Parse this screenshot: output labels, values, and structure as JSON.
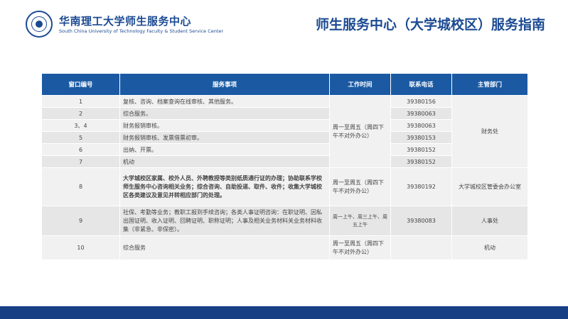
{
  "header": {
    "logo_cn": "华南理工大学师生服务中心",
    "logo_en": "South China University of Technology Faculty & Student Service Center",
    "title": "师生服务中心（大学城校区）服务指南"
  },
  "table": {
    "headers": [
      "窗口编号",
      "服务事项",
      "工作时间",
      "联系电话",
      "主管部门"
    ],
    "rows": [
      {
        "no": "1",
        "service": "复核、咨询、档案查询在线审核、其他服务。",
        "phone": "39380156"
      },
      {
        "no": "2",
        "service": "综合服务。",
        "phone": "39380063"
      },
      {
        "no": "3、4",
        "service": "财务报销审核。",
        "phone": "39380063"
      },
      {
        "no": "5",
        "service": "财务报销审核、发票借票初审。",
        "phone": "39380153"
      },
      {
        "no": "6",
        "service": "出纳、开票。",
        "phone": "39380152"
      },
      {
        "no": "7",
        "service": "机动",
        "phone": "39380152"
      },
      {
        "no": "8",
        "service": "大学城校区家属、校外人员、外聘教授等类别纸质通行证的办理；协助联系学校师生服务中心咨询相关业务；综合咨询、自助投递、取件、收件；收集大学城校区各类建议及意见并转相应部门的处理。",
        "time": "周一至周五（周四下午不对外办公）",
        "phone": "39380192",
        "dept": "大学城校区管委会办公室"
      },
      {
        "no": "9",
        "service": "社保、考勤等业务；教职工报到手续咨询；各类人事证明咨询：在职证明、因私出国证明、收入证明、回聘证明、职称证明；人事及相关业务材料关业务材料收集（非紧急、非保密）。",
        "time": "周一上午、周三上午、周五上午",
        "phone": "39380083",
        "dept": "人事处"
      },
      {
        "no": "10",
        "service": "综合服务",
        "time": "周一至周五（周四下午不对外办公）",
        "phone": "",
        "dept": "机动"
      }
    ],
    "shared_time_1_7": "周一至周五（周四下午不对外办公）",
    "shared_dept_1_7": "财务处"
  },
  "colors": {
    "brand": "#1b4a92",
    "header_bg": "#1b5aa3",
    "footer": "#163f84"
  }
}
